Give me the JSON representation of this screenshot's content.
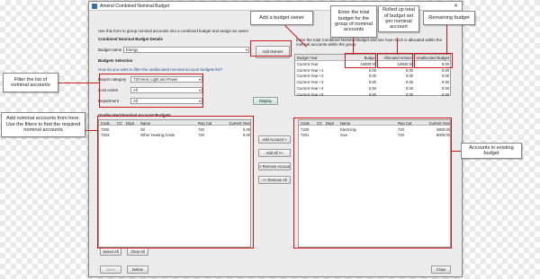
{
  "window": {
    "title": "Amend Combined Nominal Budget",
    "close_glyph": "✕"
  },
  "intro_text": "Use this form to group nominal accounts into a combined budget and assign an owner",
  "details": {
    "heading": "Combined Nominal Budget Details",
    "owner_label": "Budget name",
    "owner_value": "Energy",
    "add_owners_button": "Add Owners"
  },
  "selection": {
    "heading": "Budgets Selection",
    "question": "How do you want to filter the unallocated nominal account budgets list?",
    "filters": [
      {
        "label": "Report category",
        "value": "720 Heat, Light and Power"
      },
      {
        "label": "Cost centre",
        "value": "All"
      },
      {
        "label": "Department",
        "value": "All"
      }
    ],
    "display_button": "Display"
  },
  "summary": {
    "intro": "Enter the total Combined Nominal Budget and see how much is allocated within the nominal accounts within the group",
    "headers": [
      "Budget Year",
      "Budget",
      "Allocated Amount",
      "Unallocated Budget"
    ],
    "rows": [
      {
        "year": "Current Year",
        "budget": "10800.00",
        "allocated": "10800.00",
        "unallocated": "0.00"
      },
      {
        "year": "Current Year +1",
        "budget": "0.00",
        "allocated": "0.00",
        "unallocated": "0.00"
      },
      {
        "year": "Current Year +2",
        "budget": "0.00",
        "allocated": "0.00",
        "unallocated": "0.00"
      },
      {
        "year": "Current Year +3",
        "budget": "0.00",
        "allocated": "0.00",
        "unallocated": "0.00"
      },
      {
        "year": "Current Year +4",
        "budget": "0.00",
        "allocated": "0.00",
        "unallocated": "0.00"
      },
      {
        "year": "Current Year +5",
        "budget": "0.00",
        "allocated": "0.00",
        "unallocated": "0.00"
      }
    ]
  },
  "unallocated": {
    "heading": "Unallocated Nominal Account Budgets",
    "headers": [
      "Code",
      "CC",
      "Dept",
      "Name",
      "Rep Cat",
      "Current Year"
    ],
    "rows": [
      {
        "code": "7200",
        "cc": "",
        "dept": "",
        "name": "Oil",
        "rep": "720",
        "cy": "0.00"
      },
      {
        "code": "7203",
        "cc": "",
        "dept": "",
        "name": "Other Heating Costs",
        "rep": "720",
        "cy": "0.00"
      }
    ]
  },
  "existing": {
    "headers": [
      "Code",
      "CC",
      "Dept",
      "Name",
      "Rep Cat",
      "Current Year"
    ],
    "rows": [
      {
        "code": "7200",
        "cc": "",
        "dept": "",
        "name": "Electricity",
        "rep": "720",
        "cy": "4800.00"
      },
      {
        "code": "7201",
        "cc": "",
        "dept": "",
        "name": "Gas",
        "rep": "720",
        "cy": "6000.00"
      }
    ]
  },
  "middle_buttons": {
    "add": "Add Account >",
    "add_all": "Add All >>",
    "remove": "< Remove Account",
    "remove_all": "<< Remove All"
  },
  "bottom": {
    "select_all": "Select All",
    "clear_all": "Clear All",
    "save": "Save",
    "delete": "Delete",
    "close": "Close"
  },
  "callouts": {
    "add_owner": "Add a budget owner",
    "enter_total": "Enter the total budget for the group of nominal accounts",
    "rolled_up": "Rolled up total of budget set per nominal account",
    "remaining": "Remaining budget",
    "filter": "Filter the list of nominal accounts",
    "add_accounts": "Add nominal accounts from here. Use the filters to find the required nominal accounts",
    "existing": "Accounts in existing budget"
  }
}
